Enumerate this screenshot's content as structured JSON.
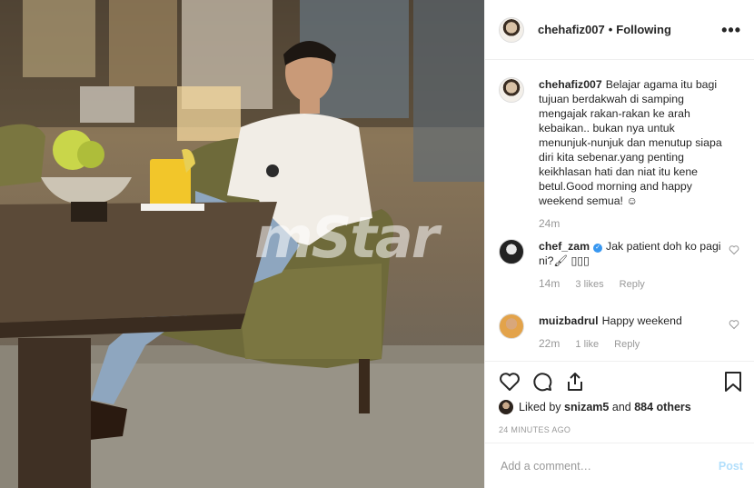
{
  "photo": {
    "watermark": "mStar",
    "alt_subject": "man-in-white-shirt-at-lounge"
  },
  "post": {
    "author": "chehafiz007",
    "follow_status": "Following",
    "caption_user": "chehafiz007",
    "caption": "Belajar agama itu bagi tujuan berdakwah di samping mengajak rakan-rakan ke arah kebaikan.. bukan nya untuk menunjuk-nunjuk dan menutup siapa diri kita sebenar.yang penting keikhlasan hati dan niat itu kene betul.Good morning and happy weekend semua! ☺",
    "caption_time": "24m"
  },
  "comments": [
    {
      "user": "chef_zam",
      "verified": true,
      "text": "Jak patient doh ko pagi ni?🖌 ▯▯▯",
      "time": "14m",
      "likes": "3 likes",
      "reply": "Reply"
    },
    {
      "user": "muizbadrul",
      "verified": false,
      "text": "Happy weekend",
      "time": "22m",
      "likes": "1 like",
      "reply": "Reply"
    }
  ],
  "likes": {
    "prefix": "Liked by",
    "user": "snizam5",
    "joiner": "and",
    "others": "884 others"
  },
  "timestamp": "24 MINUTES AGO",
  "add_comment": {
    "placeholder": "Add a comment…",
    "post_label": "Post"
  },
  "colors": {
    "link_blue": "#3897f0",
    "post_disabled": "#b2dffc",
    "muted": "#999999"
  }
}
